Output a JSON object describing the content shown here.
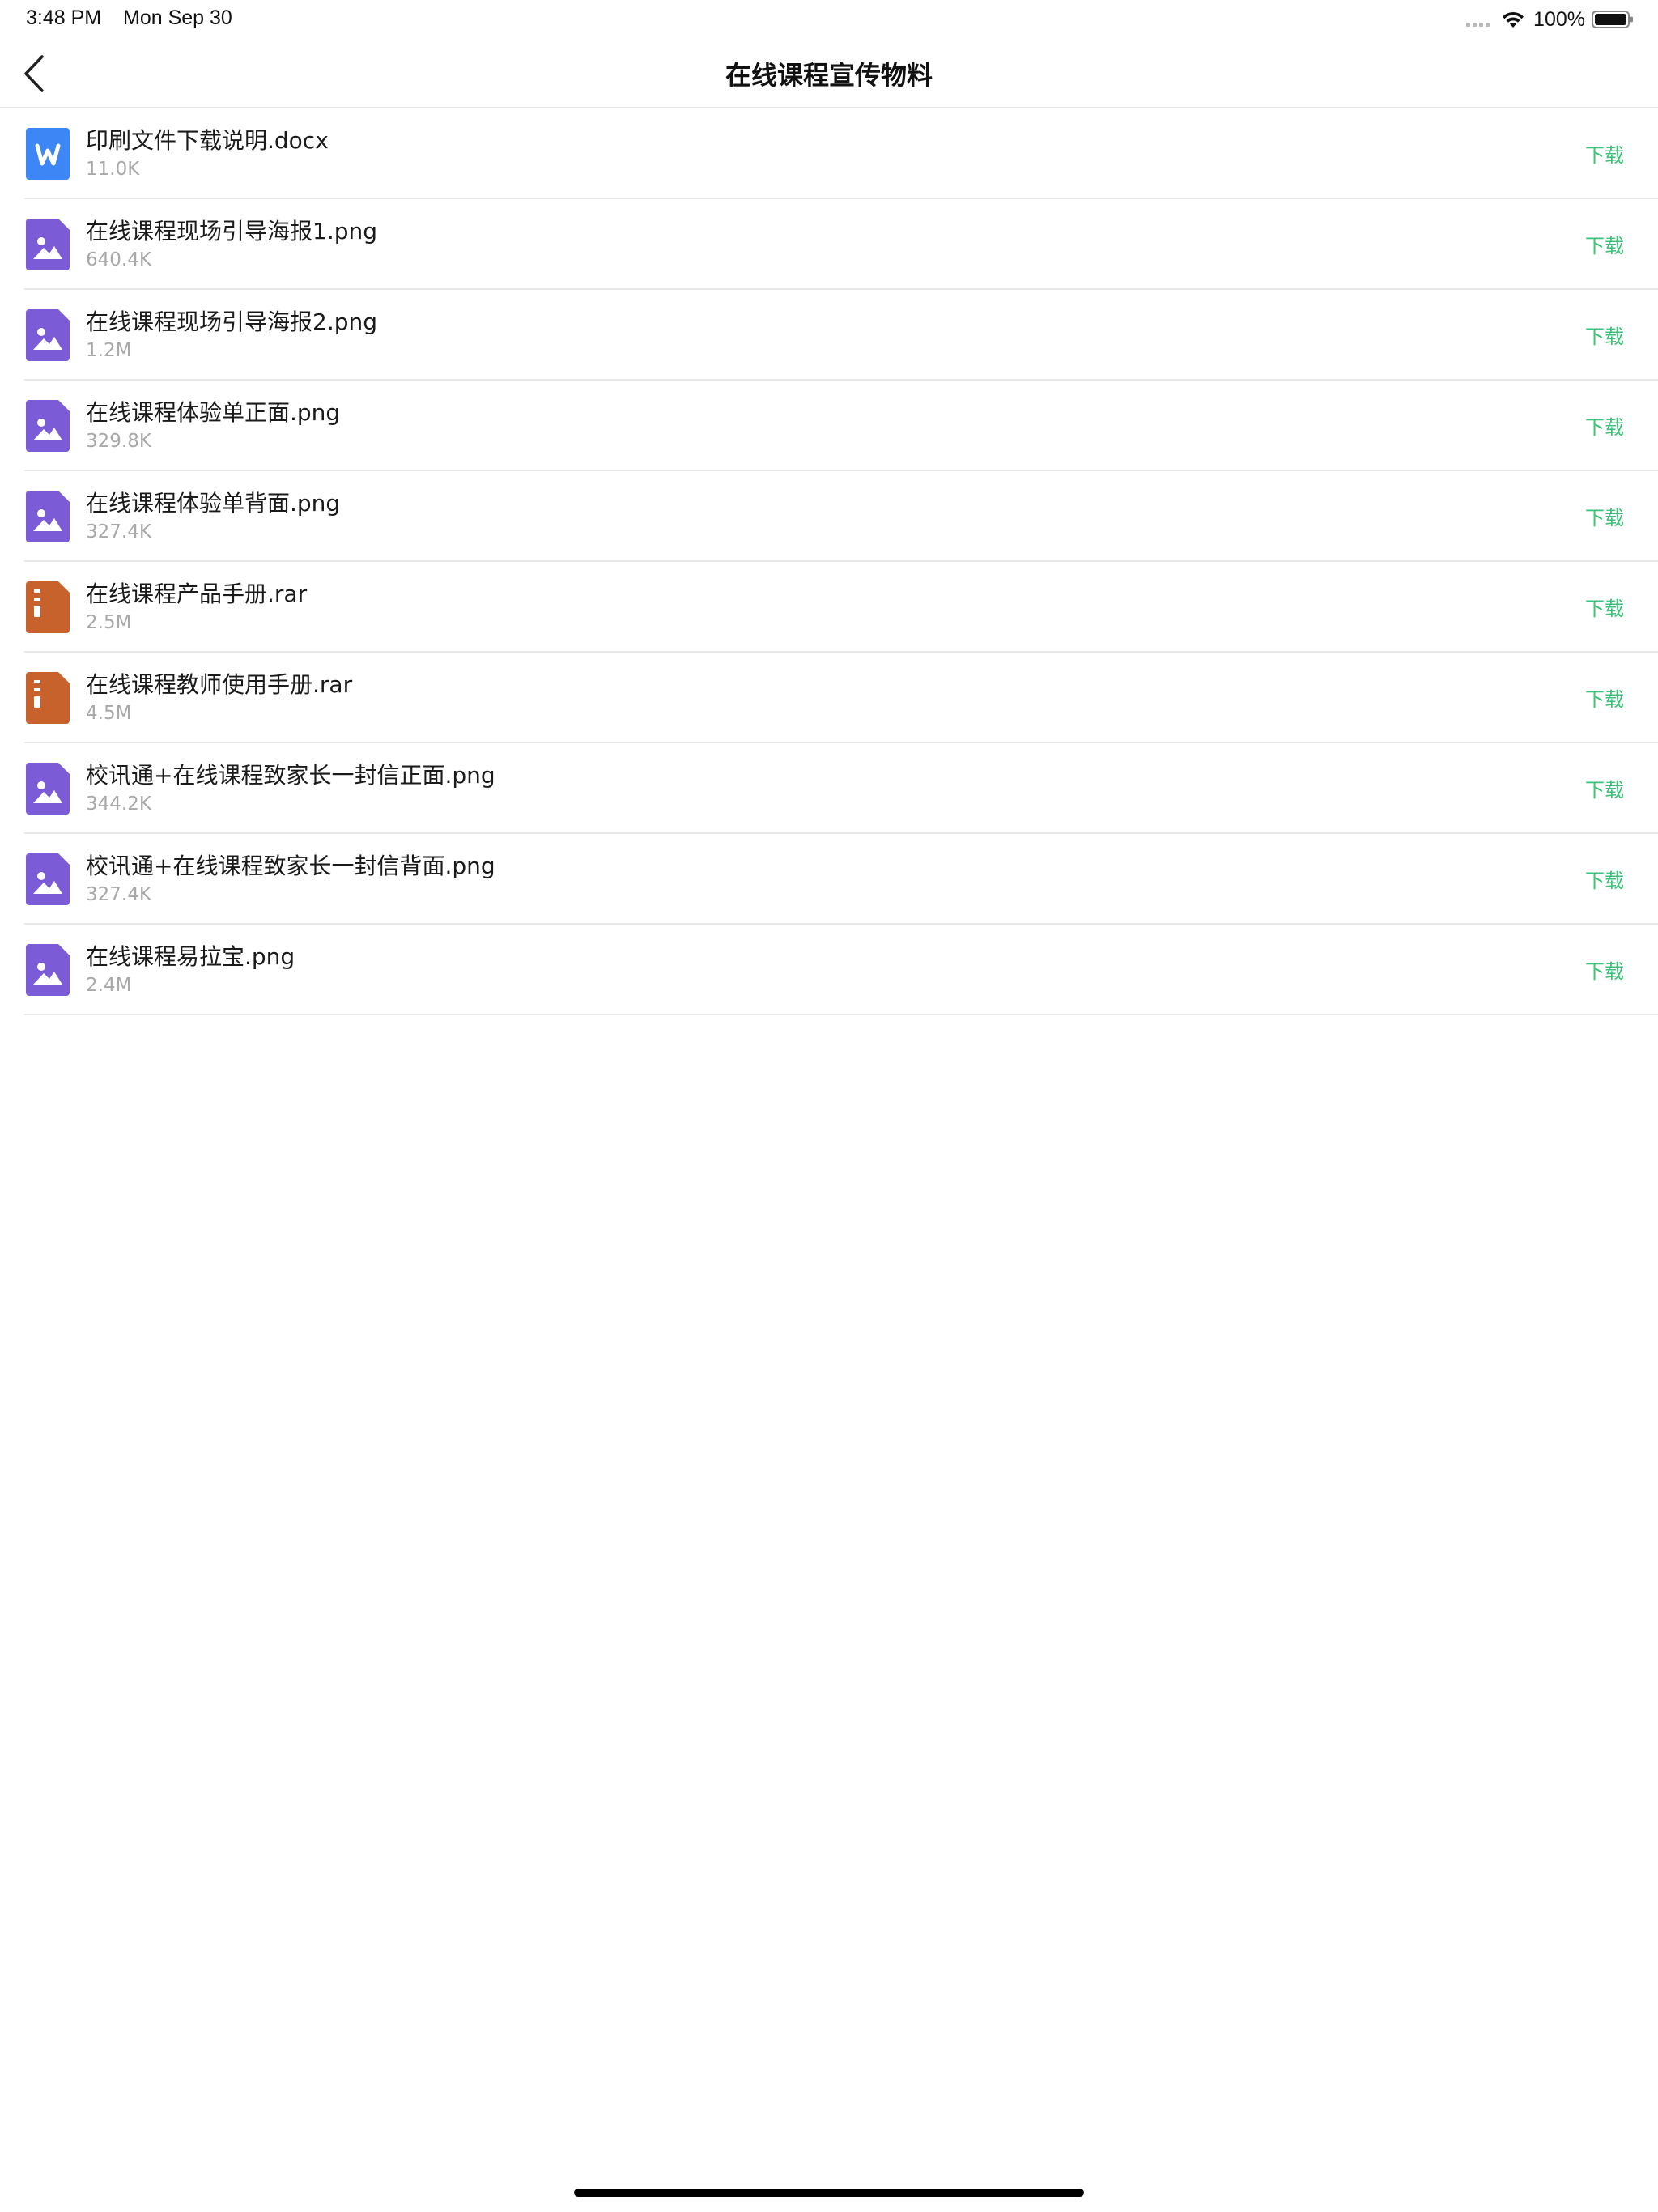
{
  "status_bar": {
    "time": "3:48 PM",
    "date": "Mon Sep 30",
    "battery": "100%",
    "icons": [
      "signal-dots-icon",
      "wifi-icon",
      "battery-icon"
    ]
  },
  "nav": {
    "back_icon": "chevron-left-icon",
    "title": "在线课程宣传物料"
  },
  "colors": {
    "download": "#3cc07a",
    "word": "#3d86f5",
    "image": "#7b5bd6",
    "archive": "#c8622c",
    "divider": "#e9e9e9"
  },
  "files": [
    {
      "name": "印刷文件下载说明.docx",
      "size": "11.0K",
      "type": "word",
      "icon": "word-doc-icon",
      "action": "下载"
    },
    {
      "name": "在线课程现场引导海报1.png",
      "size": "640.4K",
      "type": "image",
      "icon": "image-file-icon",
      "action": "下载"
    },
    {
      "name": "在线课程现场引导海报2.png",
      "size": "1.2M",
      "type": "image",
      "icon": "image-file-icon",
      "action": "下载"
    },
    {
      "name": "在线课程体验单正面.png",
      "size": "329.8K",
      "type": "image",
      "icon": "image-file-icon",
      "action": "下载"
    },
    {
      "name": "在线课程体验单背面.png",
      "size": "327.4K",
      "type": "image",
      "icon": "image-file-icon",
      "action": "下载"
    },
    {
      "name": "在线课程产品手册.rar",
      "size": "2.5M",
      "type": "archive",
      "icon": "archive-file-icon",
      "action": "下载"
    },
    {
      "name": "在线课程教师使用手册.rar",
      "size": "4.5M",
      "type": "archive",
      "icon": "archive-file-icon",
      "action": "下载"
    },
    {
      "name": "校讯通+在线课程致家长一封信正面.png",
      "size": "344.2K",
      "type": "image",
      "icon": "image-file-icon",
      "action": "下载"
    },
    {
      "name": "校讯通+在线课程致家长一封信背面.png",
      "size": "327.4K",
      "type": "image",
      "icon": "image-file-icon",
      "action": "下载"
    },
    {
      "name": "在线课程易拉宝.png",
      "size": "2.4M",
      "type": "image",
      "icon": "image-file-icon",
      "action": "下载"
    }
  ]
}
